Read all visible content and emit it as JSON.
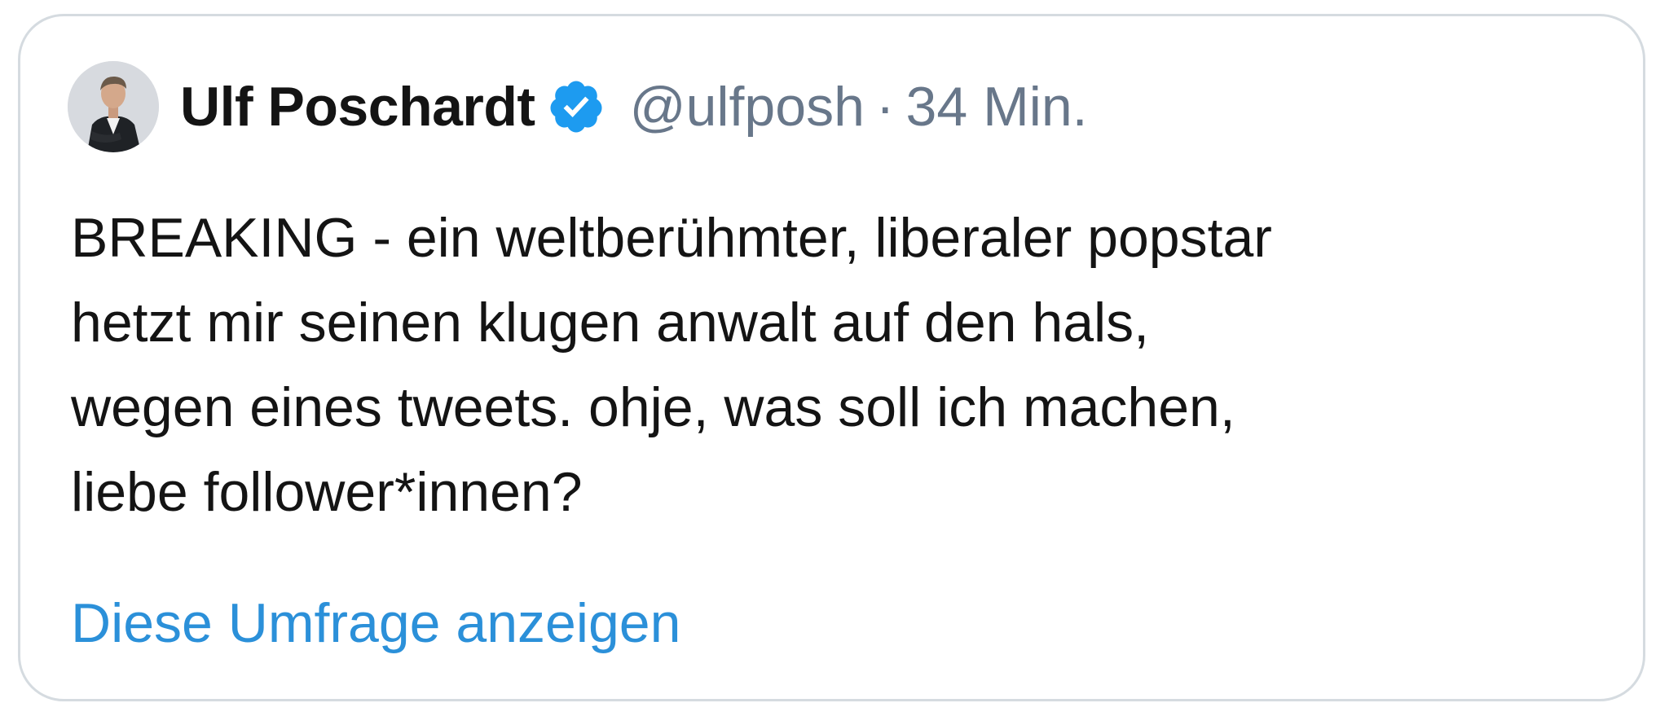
{
  "tweet": {
    "author_name": "Ulf Poschardt",
    "handle": "@ulfposh",
    "separator": "·",
    "time": "34 Min.",
    "avatar_icon": "user-avatar-photo",
    "verified_icon": "verified-badge-icon",
    "text": "BREAKING - ein weltberühmter, liberaler popstar\nhetzt mir seinen klugen anwalt auf den hals,\nwegen eines tweets. ohje, was soll ich machen,\nliebe follower*innen?",
    "poll_link_label": "Diese Umfrage anzeigen"
  },
  "colors": {
    "border": "#d5dbe0",
    "text": "#141414",
    "meta": "#68778a",
    "link": "#2b90d9",
    "verified": "#1d9bf0"
  }
}
